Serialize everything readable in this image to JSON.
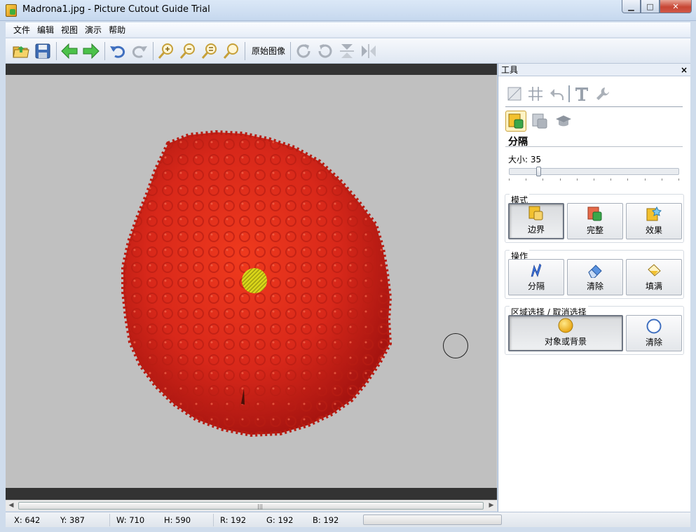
{
  "window": {
    "title": "Madrona1.jpg - Picture Cutout Guide Trial",
    "minimize": "▁",
    "maximize": "□",
    "close": "✕"
  },
  "menu": [
    "文件",
    "编辑",
    "视图",
    "演示",
    "帮助"
  ],
  "toolbar": {
    "original_image_label": "原始图像"
  },
  "panel": {
    "title": "工具",
    "close": "×",
    "section_title": "分隔",
    "size_label": "大小: 35",
    "size_value": 35,
    "groups": {
      "mode": {
        "label": "模式",
        "buttons": [
          "边界",
          "完整",
          "效果"
        ]
      },
      "operation": {
        "label": "操作",
        "buttons": [
          "分隔",
          "清除",
          "填满"
        ]
      },
      "selection": {
        "label": "区域选择 / 取消选择",
        "buttons": [
          "对象或背景",
          "清除"
        ]
      }
    }
  },
  "status": {
    "x": "X: 642",
    "y": "Y: 387",
    "w": "W: 710",
    "h": "H: 590",
    "r": "R: 192",
    "g": "G: 192",
    "b": "B: 192"
  },
  "colors": {
    "accent": "#f2c12e",
    "berry": "#d8281a",
    "canvas_bg": "#c0c0c0"
  }
}
